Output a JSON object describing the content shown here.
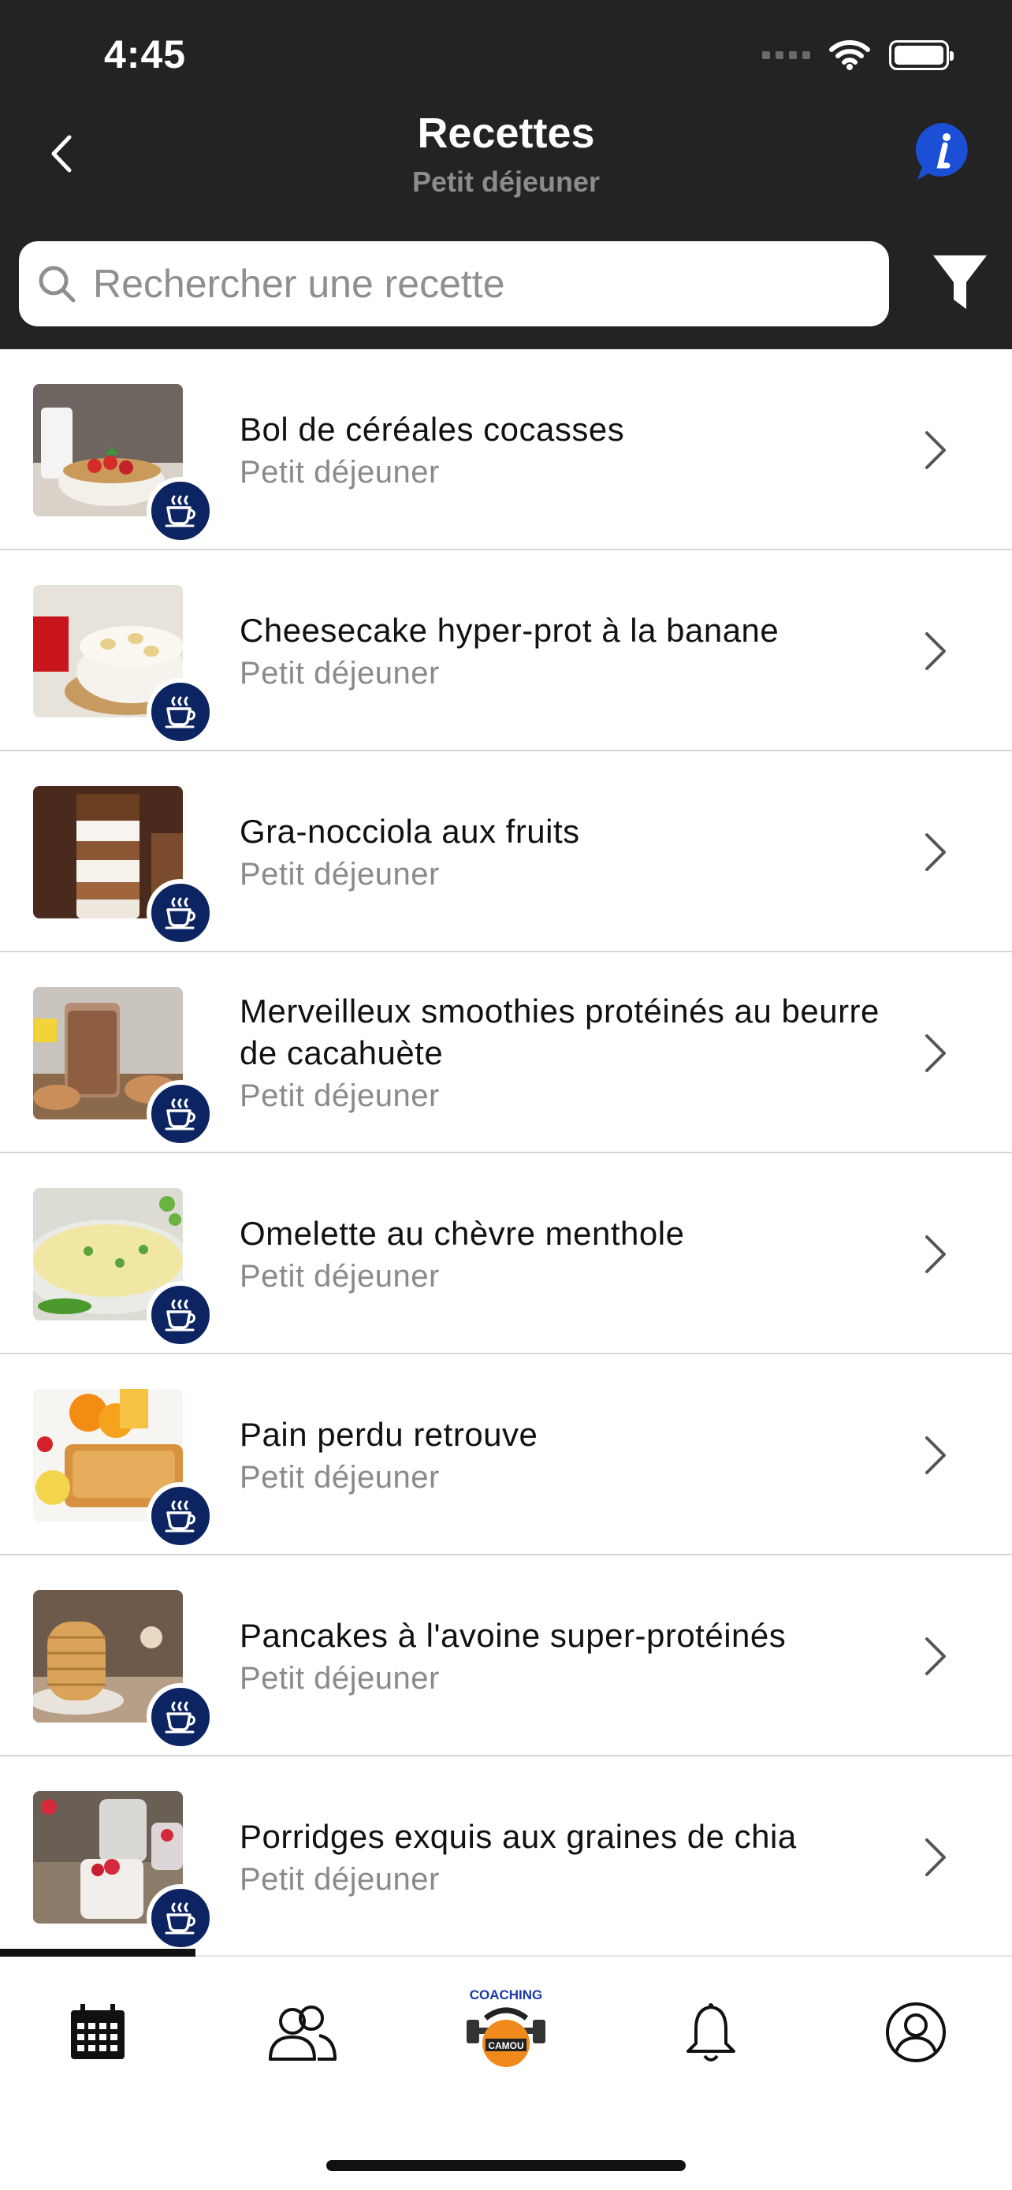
{
  "status_bar": {
    "time": "4:45"
  },
  "nav": {
    "title": "Recettes",
    "subtitle": "Petit déjeuner"
  },
  "search": {
    "placeholder": "Rechercher une recette",
    "value": ""
  },
  "recipes": [
    {
      "title": "Bol de céréales cocasses",
      "category": "Petit déjeuner"
    },
    {
      "title": "Cheesecake hyper-prot à la banane",
      "category": "Petit déjeuner"
    },
    {
      "title": "Gra-nocciola aux fruits",
      "category": "Petit déjeuner"
    },
    {
      "title": "Merveilleux smoothies protéinés au beurre de cacahuète",
      "category": "Petit déjeuner"
    },
    {
      "title": "Omelette au chèvre menthole",
      "category": "Petit déjeuner"
    },
    {
      "title": "Pain perdu retrouve",
      "category": "Petit déjeuner"
    },
    {
      "title": "Pancakes à l'avoine super-protéinés",
      "category": "Petit déjeuner"
    },
    {
      "title": "Porridges exquis aux graines de chia",
      "category": "Petit déjeuner"
    }
  ],
  "tabbar": {
    "logo_top": "COACHING",
    "logo_bottom": "CAMOU",
    "tabs": [
      "calendar-icon",
      "community-icon",
      "coaching-logo",
      "bell-icon",
      "profile-icon"
    ]
  },
  "colors": {
    "header_bg": "#232323",
    "badge": "#0c2461",
    "info": "#1a4fd6",
    "logo_orange": "#f08a1c"
  }
}
